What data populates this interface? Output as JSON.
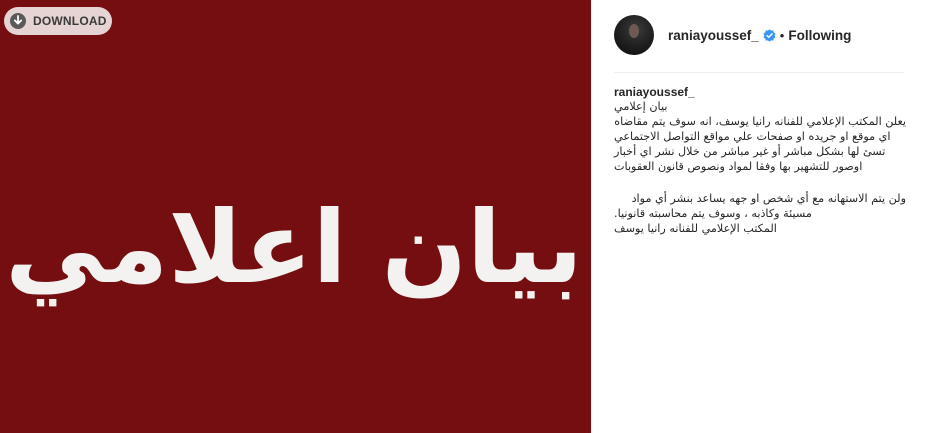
{
  "download": {
    "label": "DOWNLOAD",
    "icon": "download-arrow-circle"
  },
  "image": {
    "background_color": "#740e10",
    "headline": "بيان اعلامي"
  },
  "post": {
    "username": "raniayoussef_",
    "verified_icon": "verified-badge",
    "separator": "•",
    "follow_status": "Following"
  },
  "caption": {
    "username": "raniayoussef_",
    "line_1": "بيان إعلامي",
    "line_2": "يعلن المكتب الإعلامي للفنانه رانيا يوسف، انه سوف يتم مقاضاه",
    "line_3": "اي موقع او جريده او صفحات علي مواقع التواصل الاجتماعي",
    "line_4": "تسئ لها بشكل مباشر أو غير مباشر من خلال نشر اي أخبار",
    "line_5": "اوصور للتشهير بها وفقا لمواد ونصوص قانون العقوبات",
    "line_6": "ولن يتم الاستهانه مع أي شخص او جهه يساعد بنشر أي مواد",
    "line_7": ".مسيئة وكاذبه ، وسوف يتم محاسبته قانونيا",
    "line_8": "المكتب الإعلامي للفنانه رانيا يوسف"
  }
}
